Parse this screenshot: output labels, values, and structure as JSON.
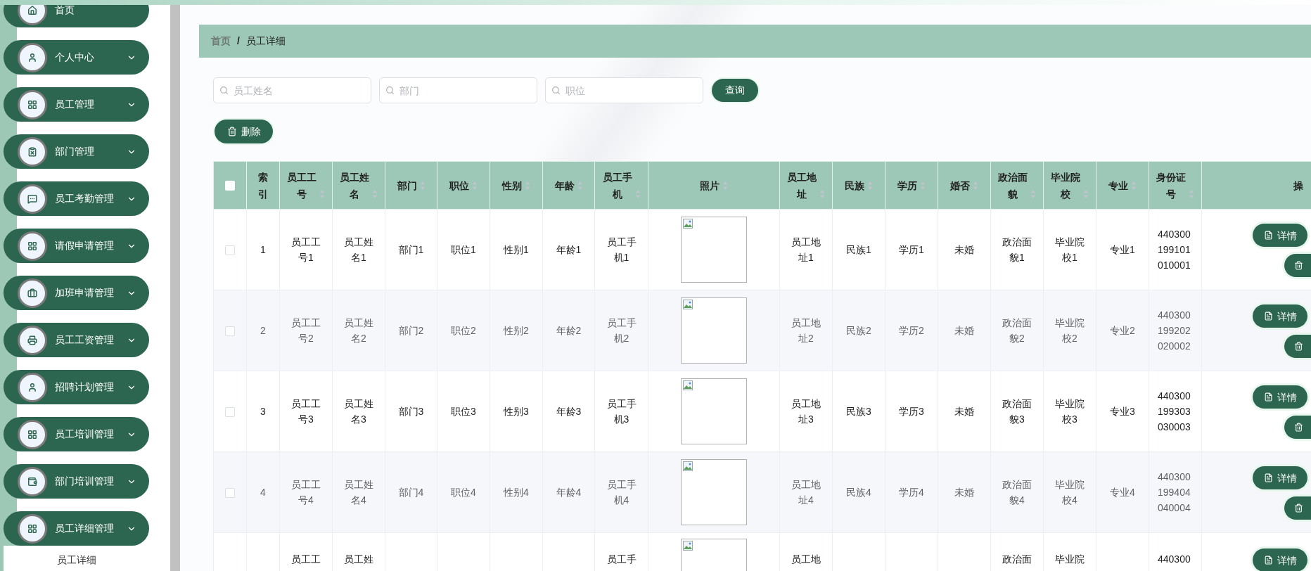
{
  "sidebar": {
    "items": [
      {
        "label": "首页",
        "kind": "link"
      },
      {
        "label": "个人中心",
        "kind": "submenu"
      },
      {
        "label": "员工管理",
        "kind": "submenu"
      },
      {
        "label": "部门管理",
        "kind": "submenu"
      },
      {
        "label": "员工考勤管理",
        "kind": "submenu"
      },
      {
        "label": "请假申请管理",
        "kind": "submenu"
      },
      {
        "label": "加班申请管理",
        "kind": "submenu"
      },
      {
        "label": "员工工资管理",
        "kind": "submenu"
      },
      {
        "label": "招聘计划管理",
        "kind": "submenu"
      },
      {
        "label": "员工培训管理",
        "kind": "submenu"
      },
      {
        "label": "部门培训管理",
        "kind": "submenu"
      },
      {
        "label": "员工详细管理",
        "kind": "submenu",
        "children": [
          {
            "label": "员工详细"
          }
        ]
      }
    ]
  },
  "breadcrumb": {
    "items": [
      "首页",
      "员工详细"
    ],
    "separator": "/"
  },
  "search": {
    "fields": [
      {
        "placeholder": "员工姓名"
      },
      {
        "placeholder": "部门"
      },
      {
        "placeholder": "职位"
      }
    ],
    "button": "查询"
  },
  "toolbar": {
    "delete_button": "删除"
  },
  "table": {
    "header_checkbox": {
      "checked": false
    },
    "columns": [
      {
        "kind": "text",
        "label": "索引",
        "sortable": false
      },
      {
        "kind": "text",
        "label": "员工工号",
        "sortable": true
      },
      {
        "kind": "text",
        "label": "员工姓名",
        "sortable": true
      },
      {
        "kind": "text",
        "label": "部门",
        "sortable": true
      },
      {
        "kind": "text",
        "label": "职位",
        "sortable": true
      },
      {
        "kind": "text",
        "label": "性别",
        "sortable": true
      },
      {
        "kind": "text",
        "label": "年龄",
        "sortable": true
      },
      {
        "kind": "text",
        "label": "员工手机",
        "sortable": true
      },
      {
        "kind": "photo",
        "label": "照片",
        "sortable": true
      },
      {
        "kind": "text",
        "label": "员工地址",
        "sortable": true
      },
      {
        "kind": "text",
        "label": "民族",
        "sortable": true
      },
      {
        "kind": "text",
        "label": "学历",
        "sortable": true
      },
      {
        "kind": "text",
        "label": "婚否",
        "sortable": true
      },
      {
        "kind": "text",
        "label": "政治面貌",
        "sortable": true
      },
      {
        "kind": "text",
        "label": "毕业院校",
        "sortable": true
      },
      {
        "kind": "text",
        "label": "专业",
        "sortable": true
      },
      {
        "kind": "id",
        "label": "身份证号",
        "sortable": true
      },
      {
        "kind": "actions",
        "label": "操",
        "sortable": false
      }
    ],
    "rows": [
      {
        "checked": false,
        "cells": [
          "1",
          "员工工号1",
          "员工姓名1",
          "部门1",
          "职位1",
          "性别1",
          "年龄1",
          "员工手机1",
          null,
          "员工地址1",
          "民族1",
          "学历1",
          "未婚",
          "政治面貌1",
          "毕业院校1",
          "专业1",
          "440300199101010001"
        ],
        "actions": [
          {
            "kind": "detail",
            "label": "详情"
          },
          {
            "kind": "delete"
          }
        ]
      },
      {
        "checked": false,
        "cells": [
          "2",
          "员工工号2",
          "员工姓名2",
          "部门2",
          "职位2",
          "性别2",
          "年龄2",
          "员工手机2",
          null,
          "员工地址2",
          "民族2",
          "学历2",
          "未婚",
          "政治面貌2",
          "毕业院校2",
          "专业2",
          "440300199202020002"
        ],
        "actions": [
          {
            "kind": "detail",
            "label": "详情"
          },
          {
            "kind": "delete"
          }
        ]
      },
      {
        "checked": false,
        "cells": [
          "3",
          "员工工号3",
          "员工姓名3",
          "部门3",
          "职位3",
          "性别3",
          "年龄3",
          "员工手机3",
          null,
          "员工地址3",
          "民族3",
          "学历3",
          "未婚",
          "政治面貌3",
          "毕业院校3",
          "专业3",
          "440300199303030003"
        ],
        "actions": [
          {
            "kind": "detail",
            "label": "详情"
          },
          {
            "kind": "delete"
          }
        ]
      },
      {
        "checked": false,
        "cells": [
          "4",
          "员工工号4",
          "员工姓名4",
          "部门4",
          "职位4",
          "性别4",
          "年龄4",
          "员工手机4",
          null,
          "员工地址4",
          "民族4",
          "学历4",
          "未婚",
          "政治面貌4",
          "毕业院校4",
          "专业4",
          "440300199404040004"
        ],
        "actions": [
          {
            "kind": "detail",
            "label": "详情"
          },
          {
            "kind": "delete"
          }
        ]
      },
      {
        "cells": [
          null,
          "员工工",
          "员工姓",
          null,
          null,
          null,
          null,
          "员工手",
          null,
          "员工地",
          null,
          null,
          null,
          "政治面",
          "毕业院",
          null,
          "440300"
        ],
        "actions": [
          {
            "kind": "detail",
            "label": "详情"
          }
        ]
      }
    ]
  }
}
